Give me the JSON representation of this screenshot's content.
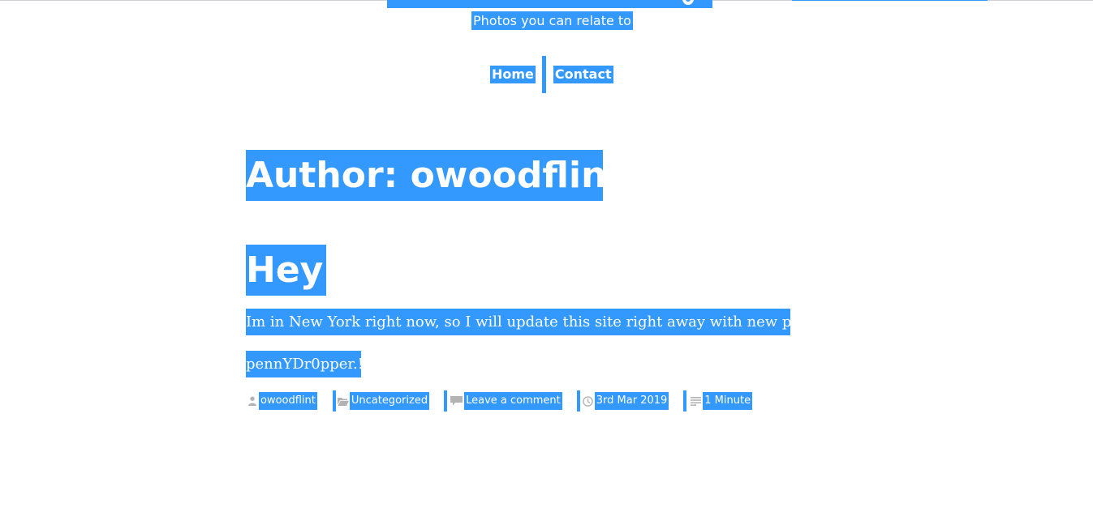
{
  "site": {
    "tagline": "Photos you can relate to"
  },
  "nav": {
    "items": [
      {
        "label": "Home"
      },
      {
        "label": "Contact"
      }
    ]
  },
  "archive": {
    "title": "Author: owoodflint"
  },
  "post": {
    "title": "Hey",
    "paragraphs": [
      "Im in New York right now, so I will update this site right away with new photos!",
      "pennYDr0pper.!"
    ],
    "meta": {
      "author": "owoodflint",
      "category": "Uncategorized",
      "comments": "Leave a comment",
      "date": "3rd Mar 2019",
      "reading_time": "1 Minute"
    }
  },
  "colors": {
    "selection_bg": "#3399ff",
    "selection_text": "#ffffff",
    "icon_gray": "#b3b3b3"
  },
  "icons": {
    "author": "person-icon",
    "category": "folder-icon",
    "comments": "speech-bubble-icon",
    "date": "clock-icon",
    "reading_time": "text-lines-icon"
  }
}
